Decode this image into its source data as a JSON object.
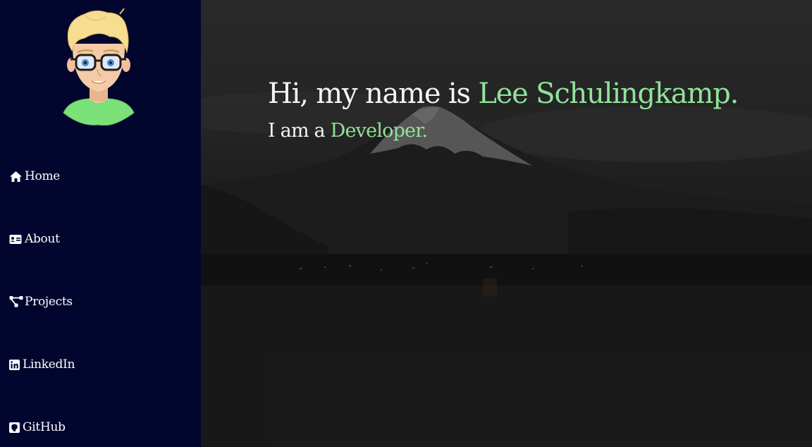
{
  "sidebar": {
    "avatar_label": "Lee Schulingkamp avatar",
    "nav": [
      {
        "label": "Home",
        "icon": "home-icon"
      },
      {
        "label": "About",
        "icon": "id-card-icon"
      },
      {
        "label": "Projects",
        "icon": "project-diagram-icon"
      },
      {
        "label": "LinkedIn",
        "icon": "linkedin-icon"
      },
      {
        "label": "GitHub",
        "icon": "github-icon"
      }
    ]
  },
  "hero": {
    "greeting": "Hi, my name is ",
    "name": "Lee Schulingkamp.",
    "role_prefix": "I am a ",
    "role": "Developer."
  },
  "colors": {
    "sidebar_bg": "#02062f",
    "accent": "#8fe39a",
    "text": "#f4f4f4"
  }
}
